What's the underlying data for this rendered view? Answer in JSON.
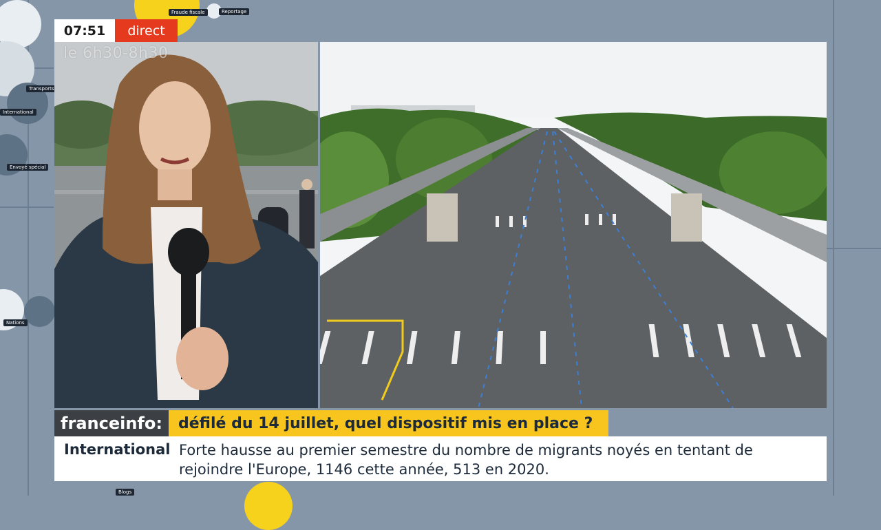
{
  "overlay": {
    "time": "07:51",
    "live_label": "direct",
    "program_label": "le 6h30-8h30"
  },
  "background": {
    "tags": [
      "Fraude fiscale",
      "Reportage",
      "Transports",
      "International",
      "Envoyé spécial",
      "Nations",
      "Blogs"
    ]
  },
  "ticker": {
    "brand": "franceinfo:",
    "headline": "défilé du 14 juillet, quel dispositif mis en place ?",
    "category": "International",
    "news": "Forte hausse au premier semestre du nombre de migrants noyés en tentant de rejoindre l'Europe, 1146 cette année, 513 en 2020."
  },
  "colors": {
    "live_red": "#e63a1e",
    "headline_yellow": "#f7c51d",
    "brand_dark": "#3c3f44",
    "background": "#8496a8"
  }
}
